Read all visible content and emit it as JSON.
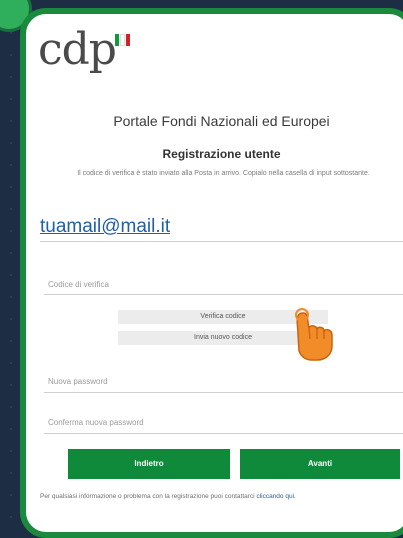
{
  "brand": {
    "logo_text": "cdp",
    "flag_colors": [
      "#0f9a3e",
      "#ffffff",
      "#d4202a"
    ]
  },
  "header": {
    "portal_title": "Portale Fondi Nazionali ed Europei",
    "section_title": "Registrazione utente",
    "info_text": "Il codice di verifica è stato inviato alla Posta in arrivo. Copialo nella casella di input sottostante."
  },
  "form": {
    "email_value": "tuamail@mail.it",
    "verification_code_placeholder": "Codice di verifica",
    "verify_button_label": "Verifica codice",
    "resend_button_label": "Invia nuovo codice",
    "new_password_placeholder": "Nuova password",
    "confirm_password_placeholder": "Conferma nuova password",
    "back_button_label": "Indietro",
    "next_button_label": "Avanti"
  },
  "footer": {
    "text": "Per qualsiasi informazione o problema con la registrazione puoi contattarci",
    "link_text": "cliccando qui."
  },
  "colors": {
    "accent_green": "#0f8a3a",
    "link_blue": "#1f5fa8",
    "background": "#1d2d44",
    "pointer_orange": "#f28c28"
  },
  "icons": {
    "pointer": "hand-pointer-icon"
  }
}
